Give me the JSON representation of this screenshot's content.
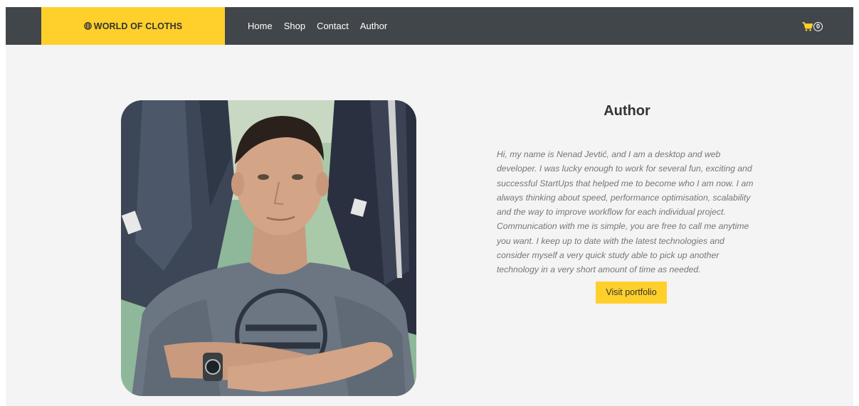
{
  "navbar": {
    "brand_label": "WORLD OF CLOTHS",
    "brand_icon": "globe-icon",
    "links": [
      "Home",
      "Shop",
      "Contact",
      "Author"
    ],
    "cart_icon": "cart-icon",
    "cart_count": "0",
    "background_color": "#41464b",
    "brand_color": "#ffd02b"
  },
  "author": {
    "heading": "Author",
    "photo_alt": "Portrait photo of the author",
    "bio": "Hi, my name is Nenad Jevtić, and I am a desktop and web developer. I was lucky enough to work for several fun, exciting and successful StartUps that helped me to become who I am now. I am always thinking about speed, performance optimisation, scalability and the way to improve workflow for each individual project. Communication with me is simple, you are free to call me anytime you want. I keep up to date with the latest technologies and consider myself a very quick study able to pick up another technology in a very short amount of time as needed.",
    "button_label": "Visit portfolio",
    "button_color": "#ffd02b"
  }
}
